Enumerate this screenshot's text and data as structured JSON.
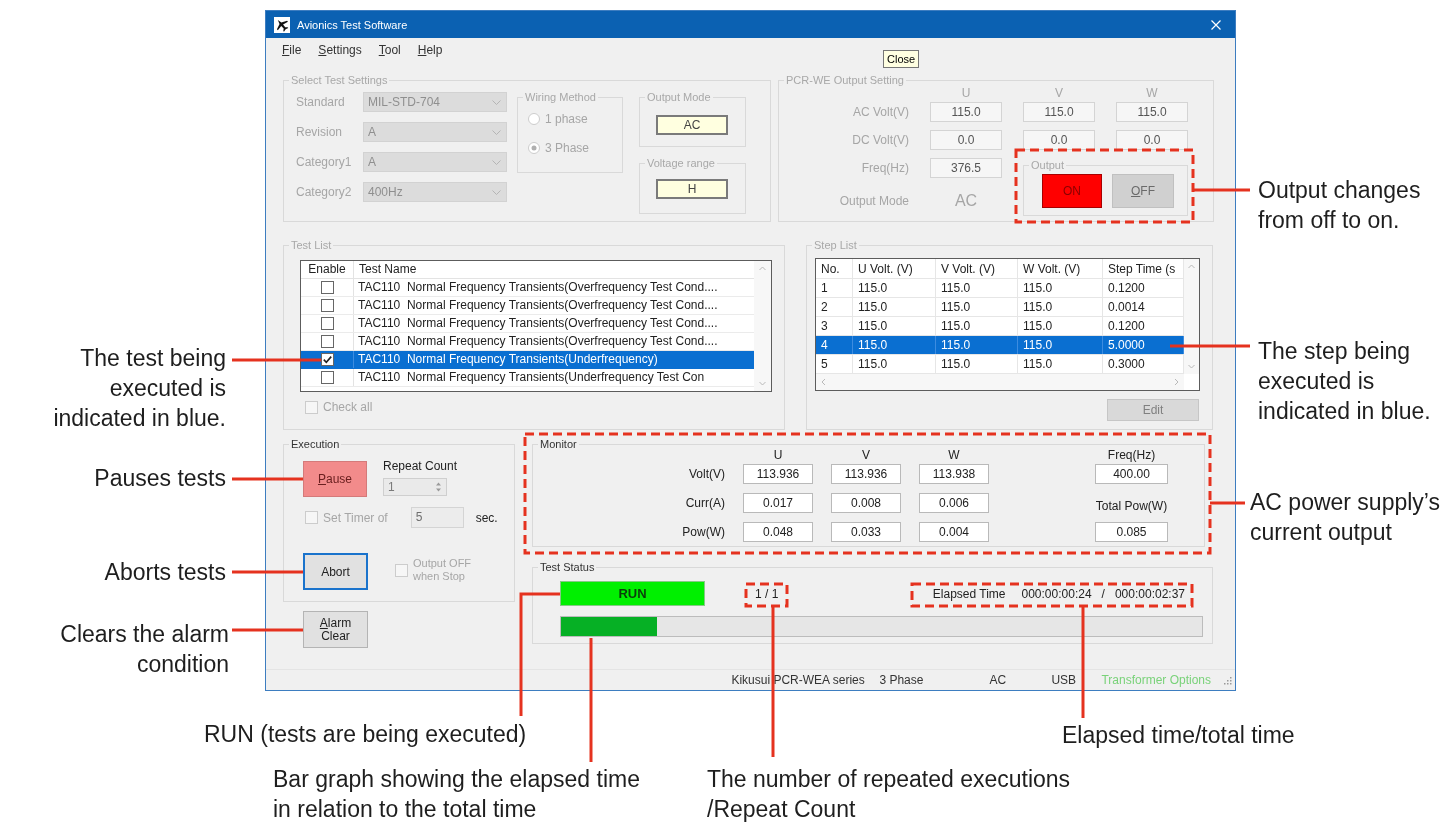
{
  "window": {
    "title": "Avionics Test Software",
    "close_tooltip": "Close"
  },
  "menu": [
    "File",
    "Settings",
    "Tool",
    "Help"
  ],
  "select_test_settings": {
    "title": "Select Test Settings",
    "disabled": true,
    "fields": [
      {
        "label": "Standard",
        "value": "MIL-STD-704"
      },
      {
        "label": "Revision",
        "value": "A"
      },
      {
        "label": "Category1",
        "value": "A"
      },
      {
        "label": "Category2",
        "value": "400Hz"
      }
    ],
    "wiring_method": {
      "title": "Wiring Method",
      "options": [
        {
          "label": "1 phase",
          "selected": false
        },
        {
          "label": "3 Phase",
          "selected": true
        }
      ]
    },
    "output_mode": {
      "title": "Output Mode",
      "value": "AC"
    },
    "voltage_range": {
      "title": "Voltage range",
      "value": "H"
    }
  },
  "output_setting": {
    "title": "PCR-WE Output Setting",
    "disabled": true,
    "columns": [
      "U",
      "V",
      "W"
    ],
    "rows": [
      {
        "label": "AC Volt(V)",
        "values": [
          "115.0",
          "115.0",
          "115.0"
        ]
      },
      {
        "label": "DC Volt(V)",
        "values": [
          "0.0",
          "0.0",
          "0.0"
        ]
      }
    ],
    "frequency": {
      "label": "Freq(Hz)",
      "value": "376.5"
    },
    "output_mode": {
      "label": "Output Mode",
      "value": "AC"
    },
    "output": {
      "title": "Output",
      "on_label": "ON",
      "off_label": "OFF",
      "on": true
    }
  },
  "test_list": {
    "title": "Test List",
    "disabled": true,
    "columns": [
      "Enable",
      "Test Name"
    ],
    "rows": [
      {
        "enabled": false,
        "name": "TAC110  Normal Frequency Transients(Overfrequency Test Cond....",
        "selected": false
      },
      {
        "enabled": false,
        "name": "TAC110  Normal Frequency Transients(Overfrequency Test Cond....",
        "selected": false
      },
      {
        "enabled": false,
        "name": "TAC110  Normal Frequency Transients(Overfrequency Test Cond....",
        "selected": false
      },
      {
        "enabled": false,
        "name": "TAC110  Normal Frequency Transients(Overfrequency Test Cond....",
        "selected": false
      },
      {
        "enabled": true,
        "name": "TAC110  Normal Frequency Transients(Underfrequency)",
        "selected": true
      },
      {
        "enabled": false,
        "name": "TAC110  Normal Frequency Transients(Underfrequency Test Con",
        "selected": false
      }
    ],
    "check_all": {
      "label": "Check all",
      "checked": false
    }
  },
  "step_list": {
    "title": "Step List",
    "disabled": true,
    "columns": [
      "No.",
      "U Volt. (V)",
      "V Volt. (V)",
      "W Volt. (V)",
      "Step Time (s"
    ],
    "rows": [
      {
        "cells": [
          "1",
          "115.0",
          "115.0",
          "115.0",
          "0.1200"
        ],
        "selected": false
      },
      {
        "cells": [
          "2",
          "115.0",
          "115.0",
          "115.0",
          "0.0014"
        ],
        "selected": false
      },
      {
        "cells": [
          "3",
          "115.0",
          "115.0",
          "115.0",
          "0.1200"
        ],
        "selected": false
      },
      {
        "cells": [
          "4",
          "115.0",
          "115.0",
          "115.0",
          "5.0000"
        ],
        "selected": true
      },
      {
        "cells": [
          "5",
          "115.0",
          "115.0",
          "115.0",
          "0.3000"
        ],
        "selected": false
      }
    ],
    "edit_button": {
      "label": "Edit",
      "disabled": true
    }
  },
  "execution": {
    "title": "Execution",
    "pause_button": {
      "label": "Pause",
      "highlighted": true
    },
    "repeat_count": {
      "label": "Repeat Count",
      "value": "1",
      "disabled": true
    },
    "set_timer": {
      "label": "Set Timer of",
      "checked": false,
      "disabled": true,
      "value": "5",
      "unit": "sec."
    },
    "abort_button": {
      "label": "Abort",
      "focused": true
    },
    "output_off": {
      "label": "Output OFF when Stop",
      "checked": false,
      "disabled": true
    },
    "alarm_clear_button": {
      "label": "Alarm Clear"
    }
  },
  "monitor": {
    "title": "Monitor",
    "columns": [
      "U",
      "V",
      "W"
    ],
    "rows": [
      {
        "label": "Volt(V)",
        "values": [
          "113.936",
          "113.936",
          "113.938"
        ]
      },
      {
        "label": "Curr(A)",
        "values": [
          "0.017",
          "0.008",
          "0.006"
        ]
      },
      {
        "label": "Pow(W)",
        "values": [
          "0.048",
          "0.033",
          "0.004"
        ]
      }
    ],
    "frequency": {
      "label": "Freq(Hz)",
      "value": "400.00"
    },
    "total_power": {
      "label": "Total Pow(W)",
      "value": "0.085"
    }
  },
  "test_status": {
    "title": "Test Status",
    "status": "RUN",
    "repeat": "1 / 1",
    "elapsed_label": "Elapsed Time",
    "elapsed": "000:00:00:24",
    "separator": "/",
    "total": "000:00:02:37",
    "progress": {
      "level": 0.15
    }
  },
  "status_bar": [
    {
      "text": "Kikusui PCR-WEA series",
      "color": "#333333"
    },
    {
      "text": "3 Phase",
      "color": "#333333"
    },
    {
      "text": "AC",
      "color": "#333333"
    },
    {
      "text": "USB",
      "color": "#333333"
    },
    {
      "text": "Transformer Options",
      "color": "#79d279"
    }
  ],
  "annotations": [
    {
      "text": "Output changes\nfrom off to on."
    },
    {
      "text": "The test being\nexecuted is\nindicated in blue."
    },
    {
      "text": "The step being\nexecuted is\nindicated in blue."
    },
    {
      "text": "Pauses tests"
    },
    {
      "text": "AC power supply’s\ncurrent output"
    },
    {
      "text": "Aborts tests"
    },
    {
      "text": "Clears the alarm\ncondition"
    },
    {
      "text": "RUN (tests are being executed)"
    },
    {
      "text": "Elapsed time/total time"
    },
    {
      "text": "Bar graph showing the elapsed time\nin relation to the total time"
    },
    {
      "text": "The number of repeated executions\n/Repeat Count"
    }
  ]
}
